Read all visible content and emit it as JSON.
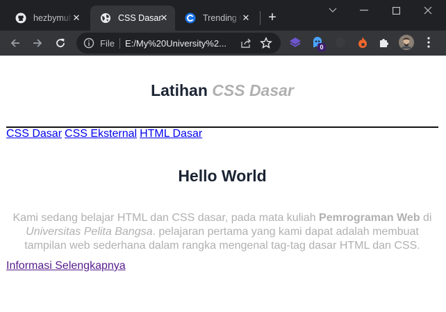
{
  "browser": {
    "tabs": [
      {
        "title": "hezbymuh",
        "favicon": "github-icon"
      },
      {
        "title": "CSS Dasar",
        "favicon": "globe-icon",
        "active": true
      },
      {
        "title": "Trending C",
        "favicon": "refresh-ring-icon"
      }
    ],
    "new_tab": "+",
    "scheme": "File",
    "url": "E:/My%20University%2..."
  },
  "page": {
    "header": {
      "title_main": "Latihan",
      "title_accent": "CSS Dasar"
    },
    "nav": [
      "CSS Dasar",
      "CSS Eksternal",
      "HTML Dasar"
    ],
    "heading": "Hello World",
    "paragraph": {
      "part1": "Kami sedang belajar HTML dan CSS dasar, pada mata kuliah ",
      "bold": "Pemrograman Web",
      "part2": " di ",
      "italic": "Universitas Pelita Bangsa",
      "part3": ". pelajaran pertama yang kami dapat adalah membuat tampilan web sederhana dalam rangka mengenal tag-tag dasar HTML dan CSS."
    },
    "more_link": "Informasi Selengkapnya"
  },
  "colors": {
    "heading": "#1b2433",
    "accent": "#b0b0b0",
    "link": "#0000ee",
    "visited": "#551a8b"
  },
  "extensions": {
    "badge": "0"
  }
}
